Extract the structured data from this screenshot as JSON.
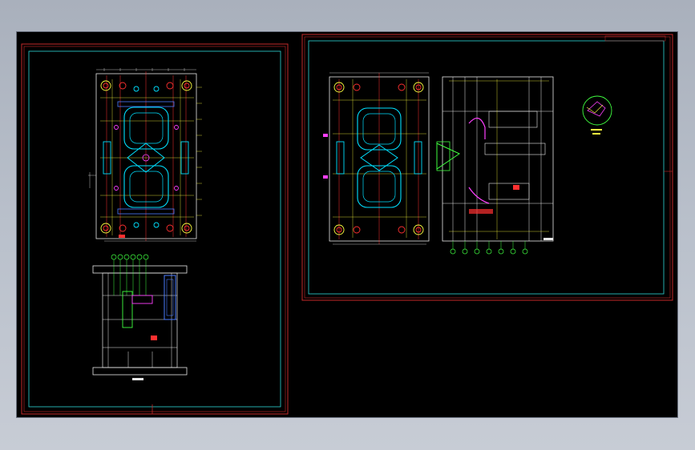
{
  "app": {
    "title": ""
  },
  "viewport": {
    "background": "#000000"
  },
  "colors": {
    "frame_red": "#d42a2a",
    "frame_cyan": "#2fd6d6",
    "outline_white": "#e8e8e8",
    "cyan": "#00e0ff",
    "yellow": "#ffff40",
    "red": "#ff3030",
    "magenta": "#ff40ff",
    "green": "#40ff40",
    "blue": "#4a7bff"
  },
  "sheets": [
    {
      "name": "left-sheet",
      "views": [
        "plan-view",
        "section-view"
      ]
    },
    {
      "name": "right-sheet",
      "views": [
        "plan-view",
        "section-view",
        "detail-circle"
      ]
    }
  ]
}
